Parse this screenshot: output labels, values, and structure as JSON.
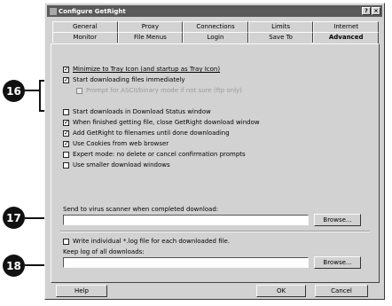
{
  "window": {
    "title": "Configure GetRight"
  },
  "tabs_row1": [
    "General",
    "Proxy",
    "Connections",
    "Limits",
    "Internet"
  ],
  "tabs_row2": [
    "Monitor",
    "File Menus",
    "Login",
    "Save To",
    "Advanced"
  ],
  "active_tab": "Advanced",
  "options": [
    {
      "label": "Minimize to Tray Icon (and startup as Tray Icon)",
      "checked": true
    },
    {
      "label": "Start downloading files immediately",
      "checked": true
    },
    {
      "label": "Prompt for ASCII/binary mode if not sure (ftp only)",
      "checked": false
    },
    {
      "label": "Start downloads in Download Status window",
      "checked": false
    },
    {
      "label": "When finished getting file, close GetRight download window",
      "checked": true
    },
    {
      "label": "Add GetRight to filenames until done downloading",
      "checked": true
    },
    {
      "label": "Use Cookies from web browser",
      "checked": true
    },
    {
      "label": "Expert mode: no delete or cancel confirmation prompts",
      "checked": false
    },
    {
      "label": "Use smaller download windows",
      "checked": false
    }
  ],
  "virus_scanner": {
    "label": "Send to virus scanner when completed download:",
    "value": "",
    "browse": "Browse..."
  },
  "write_log": {
    "label": "Write individual *.log file for each downloaded file.",
    "checked": false
  },
  "keep_log": {
    "label": "Keep log of all downloads:",
    "value": "",
    "browse": "Browse..."
  },
  "footer": {
    "help": "Help",
    "ok": "OK",
    "cancel": "Cancel"
  },
  "callouts": [
    "16",
    "17",
    "18"
  ]
}
